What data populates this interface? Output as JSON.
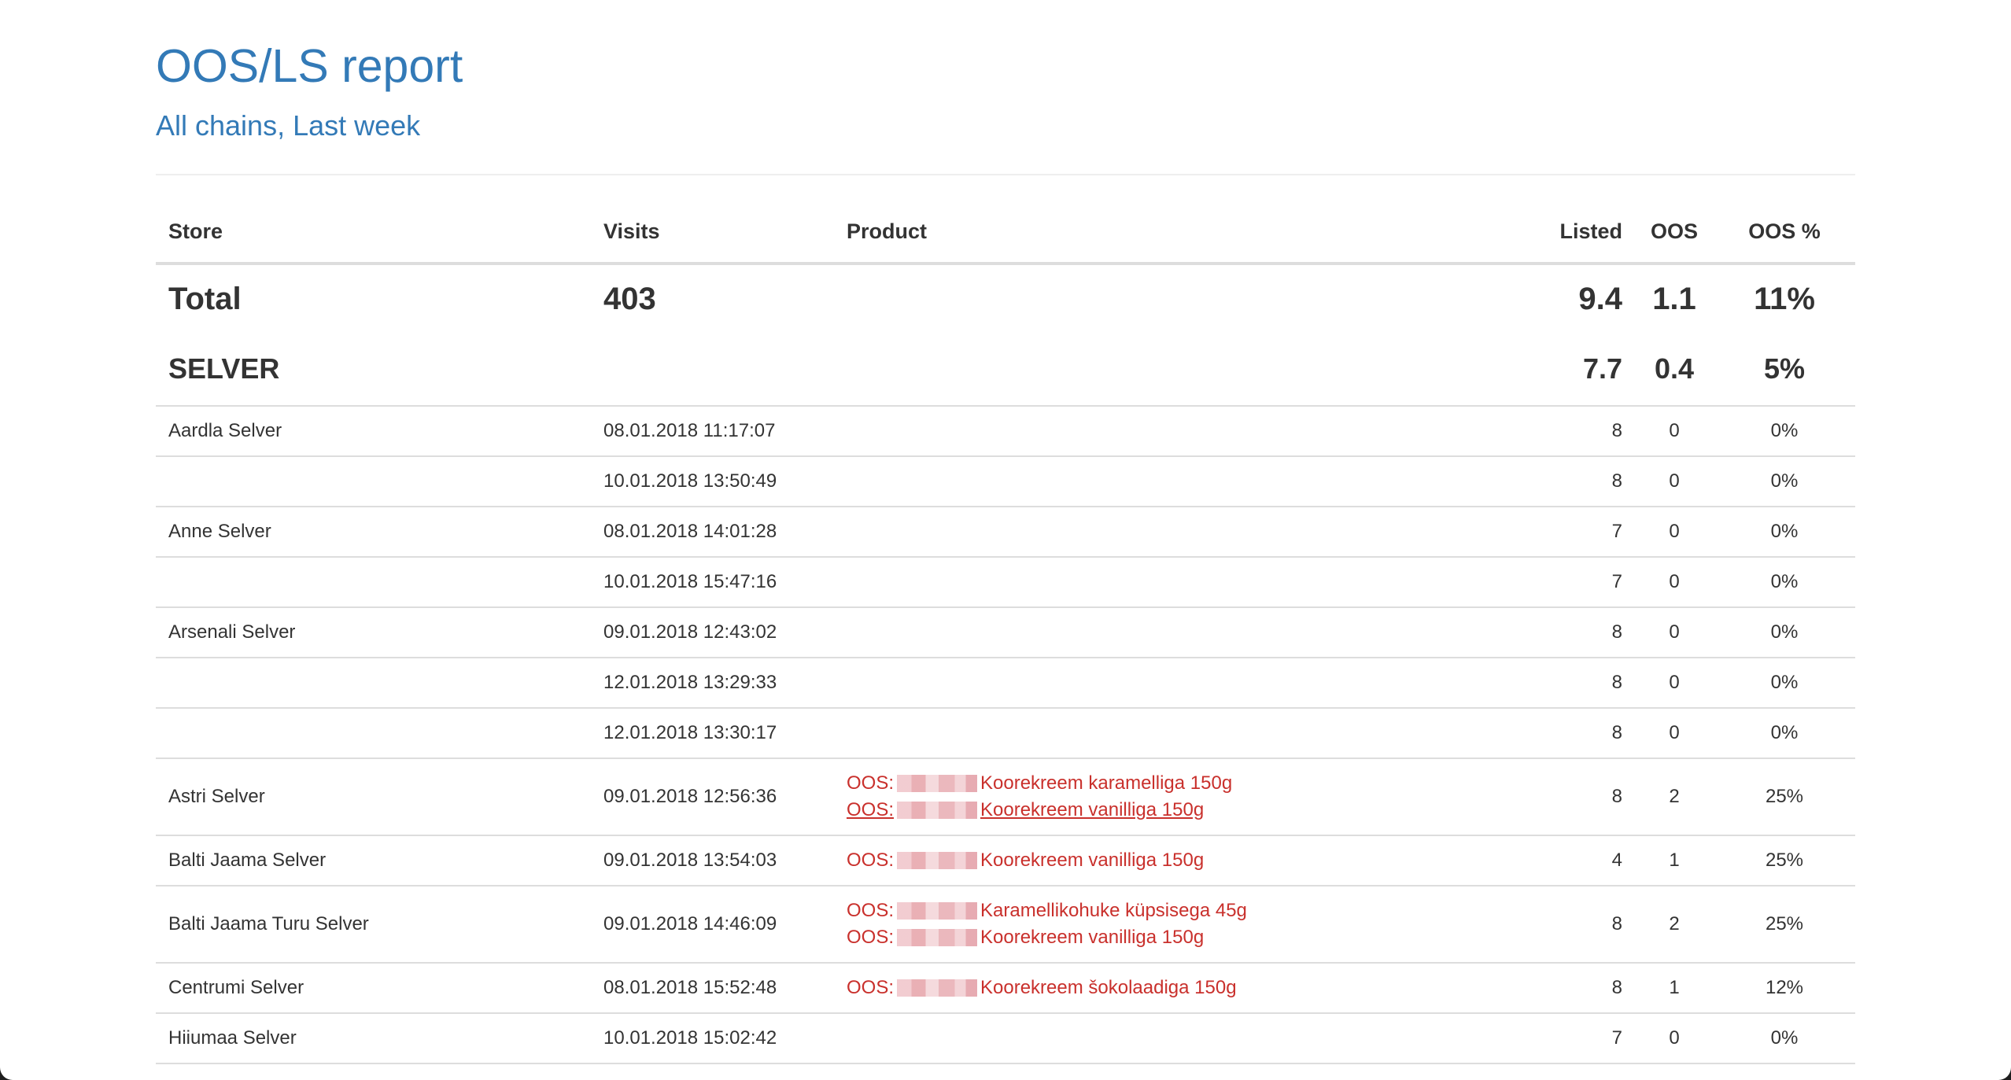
{
  "header": {
    "title": "OOS/LS report",
    "subtitle": "All chains, Last week"
  },
  "table": {
    "columns": {
      "store": "Store",
      "visits": "Visits",
      "product": "Product",
      "listed": "Listed",
      "oos": "OOS",
      "oos_pct": "OOS %"
    },
    "total": {
      "label": "Total",
      "visits": "403",
      "listed": "9.4",
      "oos": "1.1",
      "oos_pct": "11%"
    },
    "chain": {
      "label": "SELVER",
      "listed": "7.7",
      "oos": "0.4",
      "oos_pct": "5%"
    },
    "rows": [
      {
        "store": "Aardla Selver",
        "visit": "08.01.2018 11:17:07",
        "listed": "8",
        "oos": "0",
        "oos_pct": "0%",
        "products": []
      },
      {
        "store": "",
        "visit": "10.01.2018 13:50:49",
        "listed": "8",
        "oos": "0",
        "oos_pct": "0%",
        "products": []
      },
      {
        "store": "Anne Selver",
        "visit": "08.01.2018 14:01:28",
        "listed": "7",
        "oos": "0",
        "oos_pct": "0%",
        "products": []
      },
      {
        "store": "",
        "visit": "10.01.2018 15:47:16",
        "listed": "7",
        "oos": "0",
        "oos_pct": "0%",
        "products": []
      },
      {
        "store": "Arsenali Selver",
        "visit": "09.01.2018 12:43:02",
        "listed": "8",
        "oos": "0",
        "oos_pct": "0%",
        "products": []
      },
      {
        "store": "",
        "visit": "12.01.2018 13:29:33",
        "listed": "8",
        "oos": "0",
        "oos_pct": "0%",
        "products": []
      },
      {
        "store": "",
        "visit": "12.01.2018 13:30:17",
        "listed": "8",
        "oos": "0",
        "oos_pct": "0%",
        "products": []
      },
      {
        "store": "Astri Selver",
        "visit": "09.01.2018 12:56:36",
        "listed": "8",
        "oos": "2",
        "oos_pct": "25%",
        "products": [
          {
            "prefix": "OOS:",
            "name": "Koorekreem karamelliga 150g"
          },
          {
            "prefix": "OOS:",
            "name": "Koorekreem vanilliga 150g"
          }
        ]
      },
      {
        "store": "Balti Jaama Selver",
        "visit": "09.01.2018 13:54:03",
        "listed": "4",
        "oos": "1",
        "oos_pct": "25%",
        "products": [
          {
            "prefix": "OOS:",
            "name": "Koorekreem vanilliga 150g"
          }
        ]
      },
      {
        "store": "Balti Jaama Turu Selver",
        "visit": "09.01.2018 14:46:09",
        "listed": "8",
        "oos": "2",
        "oos_pct": "25%",
        "products": [
          {
            "prefix": "OOS:",
            "name": "Karamellikohuke küpsisega 45g"
          },
          {
            "prefix": "OOS:",
            "name": "Koorekreem vanilliga 150g"
          }
        ]
      },
      {
        "store": "Centrumi Selver",
        "visit": "08.01.2018 15:52:48",
        "listed": "8",
        "oos": "1",
        "oos_pct": "12%",
        "products": [
          {
            "prefix": "OOS:",
            "name": "Koorekreem šokolaadiga 150g"
          }
        ]
      },
      {
        "store": "Hiiumaa Selver",
        "visit": "10.01.2018 15:02:42",
        "listed": "7",
        "oos": "0",
        "oos_pct": "0%",
        "products": []
      }
    ]
  },
  "colors": {
    "heading": "#337ab7",
    "oos_text": "#c9302c",
    "border": "#dddddd"
  }
}
